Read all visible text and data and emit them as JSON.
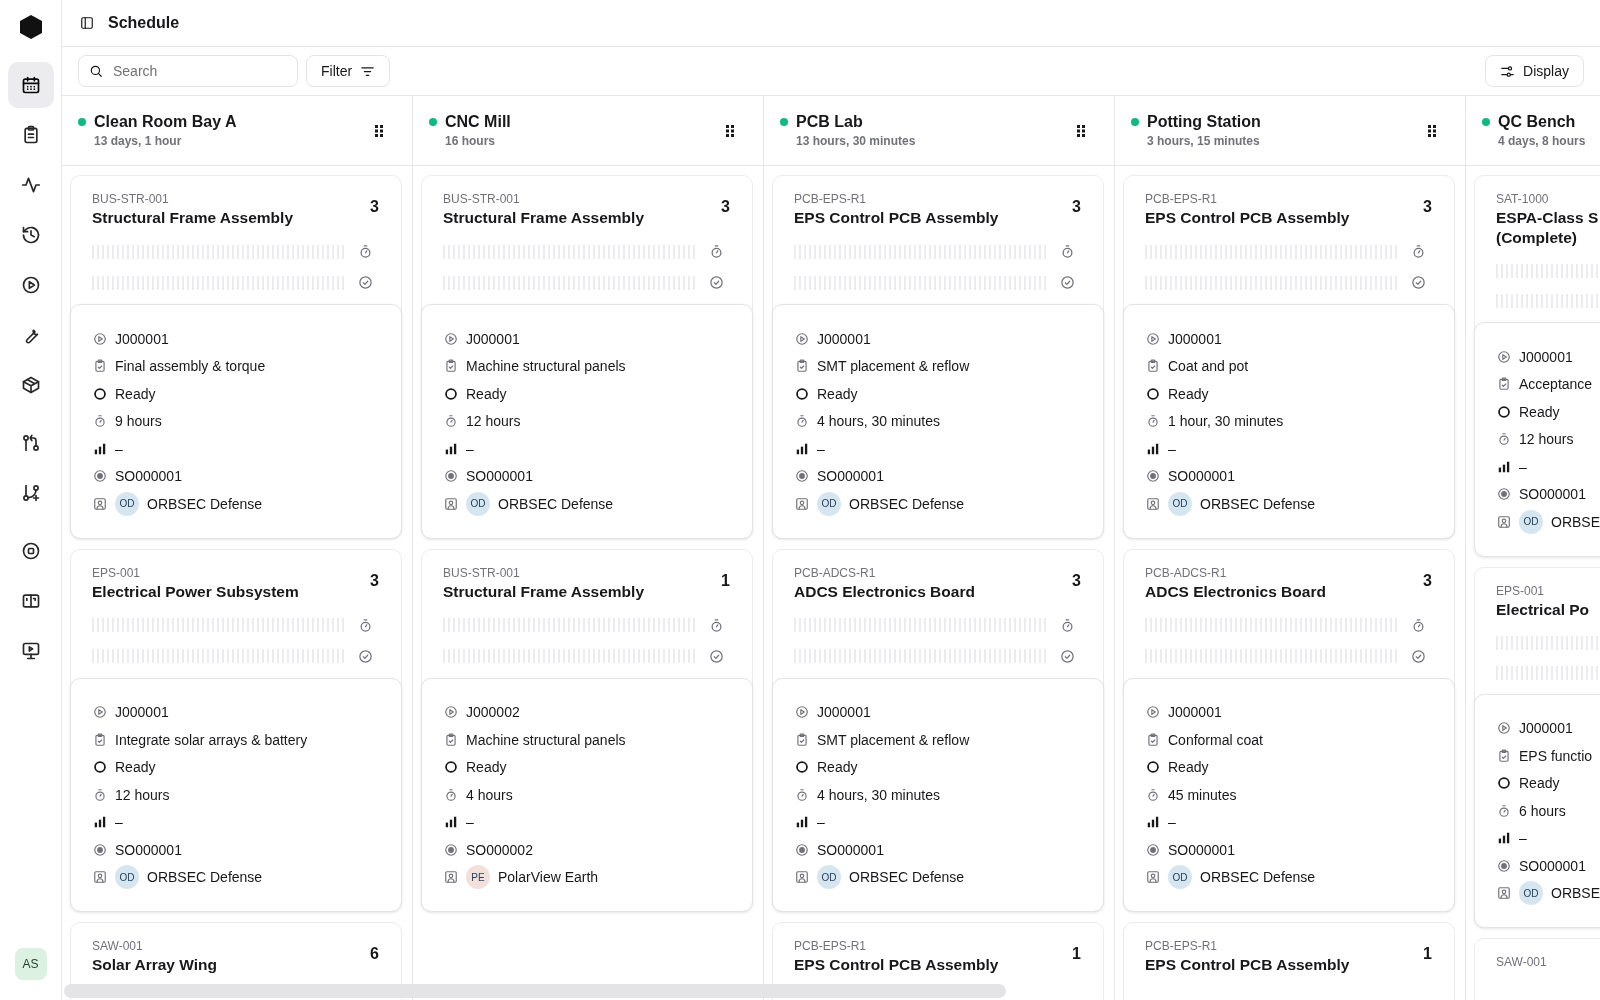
{
  "sidebar": {
    "groups": [
      {
        "items": [
          {
            "kind": "calendar",
            "selected": true
          },
          {
            "kind": "clipboard",
            "selected": false
          },
          {
            "kind": "activity",
            "selected": false
          },
          {
            "kind": "history",
            "selected": false
          },
          {
            "kind": "play",
            "selected": false
          },
          {
            "kind": "wrench",
            "selected": false
          },
          {
            "kind": "package",
            "selected": false
          }
        ]
      },
      {
        "items": [
          {
            "kind": "pull-request",
            "selected": false
          },
          {
            "kind": "branch",
            "selected": false
          }
        ]
      },
      {
        "items": [
          {
            "kind": "stop",
            "selected": false
          },
          {
            "kind": "book",
            "selected": false
          },
          {
            "kind": "monitor",
            "selected": false
          }
        ]
      }
    ],
    "user": {
      "initials": "AS"
    }
  },
  "header": {
    "title": "Schedule"
  },
  "toolbar": {
    "search": {
      "placeholder": "Search"
    },
    "filter": "Filter",
    "display": "Display"
  },
  "columns": [
    {
      "name": "Clean Room Bay A",
      "duration": "13 days, 1 hour",
      "color": "#10b981",
      "drag_handle": true,
      "cards": [
        {
          "code": "BUS-STR-001",
          "title": "Structural Frame Assembly",
          "count": "3",
          "details": {
            "job": "J000001",
            "operation": "Final assembly & torque",
            "status": "Ready",
            "duration": "9 hours",
            "priority": "–",
            "sales_order": "SO000001",
            "customer": {
              "initials": "OD",
              "name": "ORBSEC Defense",
              "color": "#d6e6f0"
            }
          }
        },
        {
          "code": "EPS-001",
          "title": "Electrical Power Subsystem",
          "count": "3",
          "details": {
            "job": "J000001",
            "operation": "Integrate solar arrays & battery",
            "status": "Ready",
            "duration": "12 hours",
            "priority": "–",
            "sales_order": "SO000001",
            "customer": {
              "initials": "OD",
              "name": "ORBSEC Defense",
              "color": "#d6e6f0"
            }
          }
        },
        {
          "code": "SAW-001",
          "title": "Solar Array Wing",
          "count": "6"
        }
      ]
    },
    {
      "name": "CNC Mill",
      "duration": "16 hours",
      "color": "#10b981",
      "drag_handle": true,
      "cards": [
        {
          "code": "BUS-STR-001",
          "title": "Structural Frame Assembly",
          "count": "3",
          "details": {
            "job": "J000001",
            "operation": "Machine structural panels",
            "status": "Ready",
            "duration": "12 hours",
            "priority": "–",
            "sales_order": "SO000001",
            "customer": {
              "initials": "OD",
              "name": "ORBSEC Defense",
              "color": "#d6e6f0"
            }
          }
        },
        {
          "code": "BUS-STR-001",
          "title": "Structural Frame Assembly",
          "count": "1",
          "details": {
            "job": "J000002",
            "operation": "Machine structural panels",
            "status": "Ready",
            "duration": "4 hours",
            "priority": "–",
            "sales_order": "SO000002",
            "customer": {
              "initials": "PE",
              "name": "PolarView Earth",
              "color": "#f3e0db"
            }
          }
        }
      ]
    },
    {
      "name": "PCB Lab",
      "duration": "13 hours, 30 minutes",
      "color": "#10b981",
      "drag_handle": true,
      "cards": [
        {
          "code": "PCB-EPS-R1",
          "title": "EPS Control PCB Assembly",
          "count": "3",
          "details": {
            "job": "J000001",
            "operation": "SMT placement & reflow",
            "status": "Ready",
            "duration": "4 hours, 30 minutes",
            "priority": "–",
            "sales_order": "SO000001",
            "customer": {
              "initials": "OD",
              "name": "ORBSEC Defense",
              "color": "#d6e6f0"
            }
          }
        },
        {
          "code": "PCB-ADCS-R1",
          "title": "ADCS Electronics Board",
          "count": "3",
          "details": {
            "job": "J000001",
            "operation": "SMT placement & reflow",
            "status": "Ready",
            "duration": "4 hours, 30 minutes",
            "priority": "–",
            "sales_order": "SO000001",
            "customer": {
              "initials": "OD",
              "name": "ORBSEC Defense",
              "color": "#d6e6f0"
            }
          }
        },
        {
          "code": "PCB-EPS-R1",
          "title": "EPS Control PCB Assembly",
          "count": "1"
        }
      ]
    },
    {
      "name": "Potting Station",
      "duration": "3 hours, 15 minutes",
      "color": "#10b981",
      "drag_handle": true,
      "cards": [
        {
          "code": "PCB-EPS-R1",
          "title": "EPS Control PCB Assembly",
          "count": "3",
          "details": {
            "job": "J000001",
            "operation": "Coat and pot",
            "status": "Ready",
            "duration": "1 hour, 30 minutes",
            "priority": "–",
            "sales_order": "SO000001",
            "customer": {
              "initials": "OD",
              "name": "ORBSEC Defense",
              "color": "#d6e6f0"
            }
          }
        },
        {
          "code": "PCB-ADCS-R1",
          "title": "ADCS Electronics Board",
          "count": "3",
          "details": {
            "job": "J000001",
            "operation": "Conformal coat",
            "status": "Ready",
            "duration": "45 minutes",
            "priority": "–",
            "sales_order": "SO000001",
            "customer": {
              "initials": "OD",
              "name": "ORBSEC Defense",
              "color": "#d6e6f0"
            }
          }
        },
        {
          "code": "PCB-EPS-R1",
          "title": "EPS Control PCB Assembly",
          "count": "1"
        }
      ]
    },
    {
      "name": "QC Bench",
      "duration": "4 days, 8 hours",
      "color": "#10b981",
      "cards": [
        {
          "code": "SAT-1000",
          "title": "ESPA-Class S\n(Complete)",
          "details": {
            "job": "J000001",
            "operation": "Acceptance",
            "status": "Ready",
            "duration": "12 hours",
            "priority": "–",
            "sales_order": "SO000001",
            "customer": {
              "initials": "OD",
              "name": "ORBSE",
              "color": "#d6e6f0"
            }
          }
        },
        {
          "code": "EPS-001",
          "title": "Electrical Po",
          "details": {
            "job": "J000001",
            "operation": "EPS functio",
            "status": "Ready",
            "duration": "6 hours",
            "priority": "–",
            "sales_order": "SO000001",
            "customer": {
              "initials": "OD",
              "name": "ORBSE",
              "color": "#d6e6f0"
            }
          }
        },
        {
          "code": "SAW-001"
        }
      ]
    }
  ]
}
